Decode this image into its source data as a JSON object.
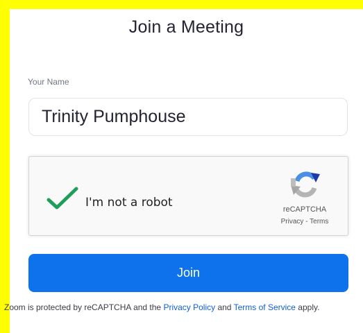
{
  "page": {
    "title": "Join a Meeting"
  },
  "form": {
    "name_label": "Your Name",
    "name_value": "Trinity Pumphouse",
    "join_label": "Join"
  },
  "captcha": {
    "label": "I'm not a robot",
    "checked": true,
    "brand": "reCAPTCHA",
    "privacy_link": "Privacy",
    "separator": " - ",
    "terms_link": "Terms"
  },
  "footer": {
    "prefix": "Zoom is protected by reCAPTCHA and the ",
    "privacy_link": "Privacy Policy",
    "middle": " and ",
    "terms_link": "Terms of Service",
    "suffix": " apply."
  },
  "colors": {
    "highlight_border": "#ffff00",
    "primary_button": "#0e72ed",
    "link": "#0e5ed9",
    "checkmark": "#1e9e5a"
  },
  "icons": {
    "check": "checkmark-icon",
    "recaptcha": "recaptcha-logo-icon"
  }
}
